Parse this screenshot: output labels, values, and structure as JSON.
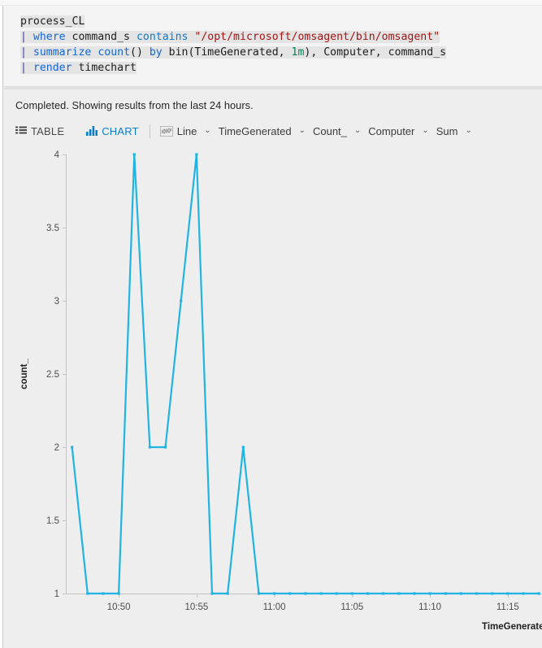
{
  "query_editor": {
    "lines": [
      {
        "segments": [
          {
            "text": "process_CL",
            "cls": "plain"
          }
        ]
      },
      {
        "segments": [
          {
            "text": "| ",
            "cls": "pipe"
          },
          {
            "text": "where",
            "cls": "kw"
          },
          {
            "text": " command_s ",
            "cls": "plain"
          },
          {
            "text": "contains",
            "cls": "kw2"
          },
          {
            "text": " ",
            "cls": "plain"
          },
          {
            "text": "\"/opt/microsoft/omsagent/bin/omsagent\"",
            "cls": "str"
          }
        ]
      },
      {
        "segments": [
          {
            "text": "| ",
            "cls": "pipe"
          },
          {
            "text": "summarize",
            "cls": "kw"
          },
          {
            "text": " ",
            "cls": "plain"
          },
          {
            "text": "count",
            "cls": "fn"
          },
          {
            "text": "() ",
            "cls": "plain"
          },
          {
            "text": "by",
            "cls": "kw"
          },
          {
            "text": " bin(TimeGenerated, ",
            "cls": "plain"
          },
          {
            "text": "1m",
            "cls": "num"
          },
          {
            "text": "), Computer, command_s",
            "cls": "plain"
          }
        ]
      },
      {
        "segments": [
          {
            "text": "| ",
            "cls": "pipe"
          },
          {
            "text": "render",
            "cls": "kw"
          },
          {
            "text": " timechart",
            "cls": "plain"
          }
        ]
      }
    ]
  },
  "results": {
    "status_text": "Completed. Showing results from the last 24 hours.",
    "toolbar": {
      "table_label": "TABLE",
      "chart_label": "CHART",
      "line_label": "Line",
      "x_axis_label": "TimeGenerated",
      "y_axis_label": "Count_",
      "split_by_label": "Computer",
      "aggregation_label": "Sum",
      "chevron_glyph": "⌄",
      "selected": "CHART",
      "accent_color": "#0a7ec9",
      "inactive_color": "#3b3b3b"
    }
  },
  "chart_data": {
    "type": "line",
    "title": "",
    "xlabel": "TimeGenerated",
    "ylabel": "count_",
    "series_color": "#21b4e2",
    "grid": false,
    "legend": "none",
    "ylim": [
      1,
      4
    ],
    "ytick_labels": [
      "1",
      "1.5",
      "2",
      "2.5",
      "3",
      "3.5",
      "4"
    ],
    "ytick_values": [
      1,
      1.5,
      2,
      2.5,
      3,
      3.5,
      4
    ],
    "xtick_labels": [
      "10:50",
      "10:55",
      "11:00",
      "11:05",
      "11:10",
      "11:15"
    ],
    "xtick_minutes": [
      50,
      55,
      60,
      65,
      70,
      75
    ],
    "xlim_minutes": [
      46.6,
      77.2
    ],
    "x": [
      "10:46",
      "10:47",
      "10:48",
      "10:49",
      "10:50",
      "10:51",
      "10:52",
      "10:53",
      "10:54",
      "10:55",
      "10:56",
      "10:57",
      "10:58",
      "10:59",
      "11:00",
      "11:01",
      "11:02",
      "11:03",
      "11:04",
      "11:05",
      "11:06",
      "11:07",
      "11:08",
      "11:09",
      "11:10",
      "11:11",
      "11:12",
      "11:13",
      "11:14",
      "11:15",
      "11:16",
      "11:17"
    ],
    "values": [
      1,
      2,
      1,
      1,
      1,
      4,
      2,
      2,
      3,
      4,
      1,
      1,
      2,
      1,
      1,
      1,
      1,
      1,
      1,
      1,
      1,
      1,
      1,
      1,
      1,
      1,
      1,
      1,
      1,
      1,
      1,
      1
    ]
  }
}
